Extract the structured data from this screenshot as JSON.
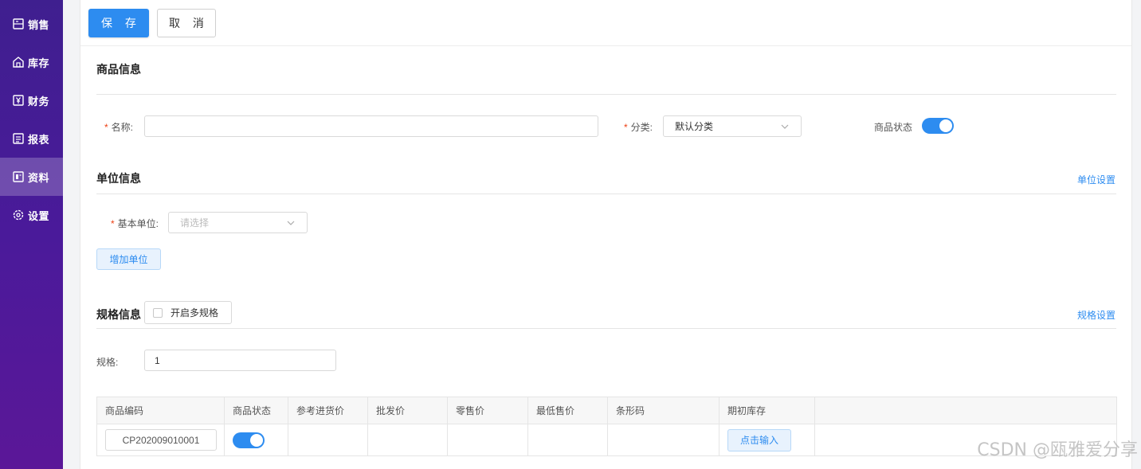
{
  "sidebar": {
    "items": [
      {
        "label": "销售",
        "icon": "receipt-icon"
      },
      {
        "label": "库存",
        "icon": "warehouse-icon"
      },
      {
        "label": "财务",
        "icon": "yen-icon"
      },
      {
        "label": "报表",
        "icon": "report-icon"
      },
      {
        "label": "资料",
        "icon": "document-icon",
        "active": true
      },
      {
        "label": "设置",
        "icon": "gear-icon"
      }
    ]
  },
  "toolbar": {
    "save_label": "保 存",
    "cancel_label": "取 消"
  },
  "product_info": {
    "title": "商品信息",
    "name_label": "名称:",
    "name_value": "",
    "category_label": "分类:",
    "category_value": "默认分类",
    "status_label": "商品状态",
    "status_on": true
  },
  "unit_info": {
    "title": "单位信息",
    "settings_link": "单位设置",
    "base_unit_label": "基本单位:",
    "base_unit_placeholder": "请选择",
    "add_unit_label": "增加单位"
  },
  "spec_info": {
    "title": "规格信息",
    "multi_spec_label": "开启多规格",
    "multi_spec_checked": false,
    "settings_link": "规格设置",
    "spec_label": "规格:",
    "spec_value": "1"
  },
  "table": {
    "headers": [
      "商品编码",
      "商品状态",
      "参考进货价",
      "批发价",
      "零售价",
      "最低售价",
      "条形码",
      "期初库存",
      ""
    ],
    "row": {
      "code": "CP202009010001",
      "status_on": true,
      "stock_button": "点击输入"
    }
  },
  "watermark": "CSDN @瓯雅爱分享",
  "colors": {
    "primary": "#2d8cf0",
    "sidebar": "#4a1a9a"
  }
}
